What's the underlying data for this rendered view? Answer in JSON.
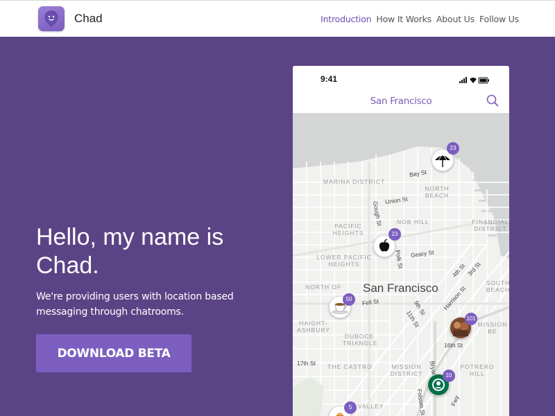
{
  "header": {
    "brand": "Chad",
    "nav": [
      "Introduction",
      "How It Works",
      "About Us",
      "Follow Us"
    ],
    "active_nav": "Introduction"
  },
  "hero": {
    "headline": "Hello, my name is Chad.",
    "subtext": "We're providing users with location based messaging through chatrooms.",
    "cta_label": "DOWNLOAD BETA"
  },
  "phone": {
    "time": "9:41",
    "title": "San Francisco",
    "map": {
      "city_label": "San Francisco",
      "district_labels": {
        "marina": "MARINA DISTRICT",
        "north_beach": "NORTH BEACH",
        "pacific_heights": "PACIFIC HEIGHTS",
        "nob_hill": "NOB HILL",
        "financial": "FINANCIAL DISTRICT",
        "lower_pacific": "LOWER PACIFIC HEIGHTS",
        "north_of": "NORTH OF",
        "south_beach": "SOUTH BEACH",
        "haight": "HAIGHT-ASHBURY",
        "duboce": "DUBOCE TRIANGLE",
        "castro": "THE CASTRO",
        "mission": "MISSION DISTRICT",
        "mission_be": "MISSION BE",
        "potrero": "POTRERO HILL",
        "valley": "VALLEY"
      },
      "streets": {
        "bay": "Bay St",
        "union": "Union St",
        "gough": "Gough St",
        "polk": "Polk St",
        "geary": "Geary St",
        "fell": "Fell St",
        "harrison": "Harrison St",
        "fourth": "4th St",
        "third": "3rd St",
        "ninth": "9th St",
        "eleventh": "11th St",
        "sixteenth": "16th St",
        "seventeenth": "17th St",
        "bryant": "Bryant St",
        "folsom": "Folsom St",
        "fwy": "Fwy"
      },
      "pins": [
        {
          "name": "umbrella",
          "count": "23"
        },
        {
          "name": "apple",
          "count": "23"
        },
        {
          "name": "coffee",
          "count": "50"
        },
        {
          "name": "photo",
          "count": "101"
        },
        {
          "name": "starbucks",
          "count": "10"
        },
        {
          "name": "small",
          "count": "5"
        }
      ]
    }
  },
  "colors": {
    "background": "#5b4485",
    "accent": "#7b5ebf",
    "active_nav": "#6d4fb3"
  }
}
